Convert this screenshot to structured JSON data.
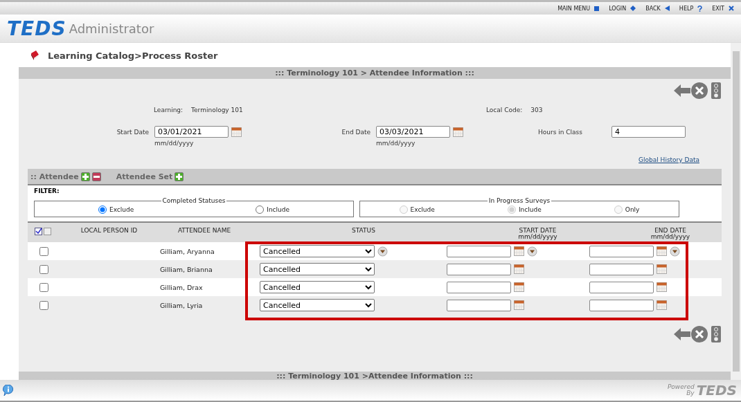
{
  "top_menu": [
    {
      "label": "MAIN MENU"
    },
    {
      "label": "LOGIN"
    },
    {
      "label": "BACK"
    },
    {
      "label": "HELP"
    },
    {
      "label": "EXIT"
    }
  ],
  "header": {
    "logo": "TEDS",
    "app_name": "Administrator"
  },
  "breadcrumb": "Learning Catalog>Process Roster",
  "panel_title": "::: Terminology 101 > Attendee Information :::",
  "info": [
    {
      "label": "Learning:",
      "value": "Terminology 101"
    },
    {
      "label": "Local Code:",
      "value": "303"
    }
  ],
  "dates": [
    {
      "label": "Start Date",
      "value": "03/01/2021",
      "hint": "mm/dd/yyyy",
      "kind": "date"
    },
    {
      "label": "End Date",
      "value": "03/03/2021",
      "hint": "mm/dd/yyyy",
      "kind": "date"
    },
    {
      "label": "Hours in Class",
      "value": "4",
      "kind": "text"
    }
  ],
  "history_link": "Global History Data",
  "attendee_bar": [
    {
      "label": ":: Attendee",
      "remove": true
    },
    {
      "label": "Attendee Set",
      "remove": false
    }
  ],
  "filter": {
    "label": "FILTER:",
    "groups": [
      {
        "legend": "Completed Statuses",
        "disabled": false,
        "options": [
          {
            "label": "Exclude",
            "selected": true
          },
          {
            "label": "Include",
            "selected": false
          }
        ]
      },
      {
        "legend": "In Progress Surveys",
        "disabled": true,
        "options": [
          {
            "label": "Exclude",
            "selected": false
          },
          {
            "label": "Include",
            "selected": true
          },
          {
            "label": "Only",
            "selected": false
          }
        ]
      }
    ]
  },
  "table": {
    "columns": [
      {
        "label": "LOCAL PERSON ID"
      },
      {
        "label": "ATTENDEE NAME"
      },
      {
        "label": "STATUS"
      },
      {
        "label": "START DATE",
        "hint": "mm/dd/yyyy"
      },
      {
        "label": "END DATE",
        "hint": "mm/dd/yyyy"
      }
    ],
    "select_all_checked": true,
    "deselect_all_checked": false,
    "rows": [
      {
        "checked": false,
        "name": "Gilliam, Aryanna",
        "status": "Cancelled",
        "fill_down": true
      },
      {
        "checked": false,
        "name": "Gilliam, Brianna",
        "status": "Cancelled",
        "fill_down": false
      },
      {
        "checked": false,
        "name": "Gilliam, Drax",
        "status": "Cancelled",
        "fill_down": false
      },
      {
        "checked": false,
        "name": "Gilliam, Lyria",
        "status": "Cancelled",
        "fill_down": false
      }
    ]
  },
  "footer_title": "::: Terminology 101 >Attendee Information :::",
  "powered_by": {
    "line1": "Powered",
    "line2": "By",
    "logo": "TEDS"
  }
}
